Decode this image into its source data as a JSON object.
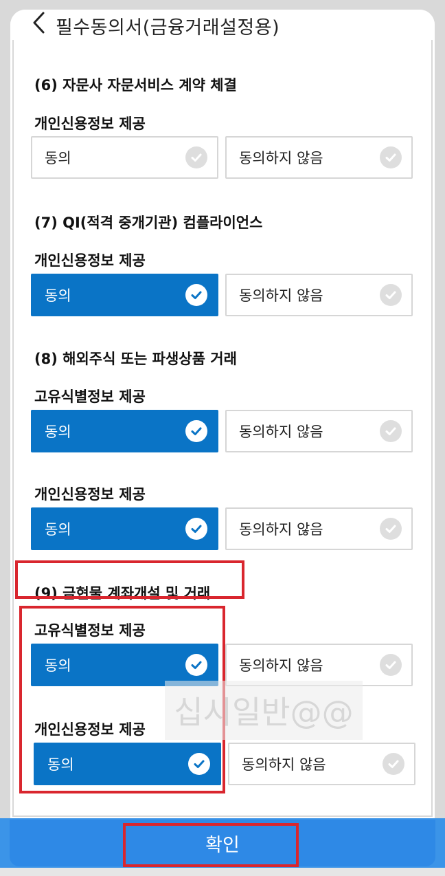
{
  "header": {
    "title": "필수동의서(금융거래설정용)"
  },
  "options": {
    "agree": "동의",
    "disagree": "동의하지 않음"
  },
  "sections": [
    {
      "title": "(6) 자문사 자문서비스 계약 체결",
      "items": [
        {
          "label": "개인신용정보 제공",
          "selected": "none"
        }
      ]
    },
    {
      "title": "(7) QI(적격 중개기관) 컴플라이언스",
      "items": [
        {
          "label": "개인신용정보 제공",
          "selected": "agree"
        }
      ]
    },
    {
      "title": "(8) 해외주식 또는 파생상품 거래",
      "items": [
        {
          "label": "고유식별정보 제공",
          "selected": "agree"
        },
        {
          "label": "개인신용정보 제공",
          "selected": "agree"
        }
      ]
    },
    {
      "title": "(9) 금현물 계좌개설 및 거래",
      "items": [
        {
          "label": "고유식별정보 제공",
          "selected": "agree"
        },
        {
          "label": "개인신용정보 제공",
          "selected": "agree"
        }
      ]
    }
  ],
  "watermark": "십시일반@@",
  "footer": {
    "confirm_label": "확인"
  },
  "colors": {
    "selected": "#0a74c6",
    "confirm_bar": "#3b94e8",
    "highlight": "#d9262e"
  }
}
